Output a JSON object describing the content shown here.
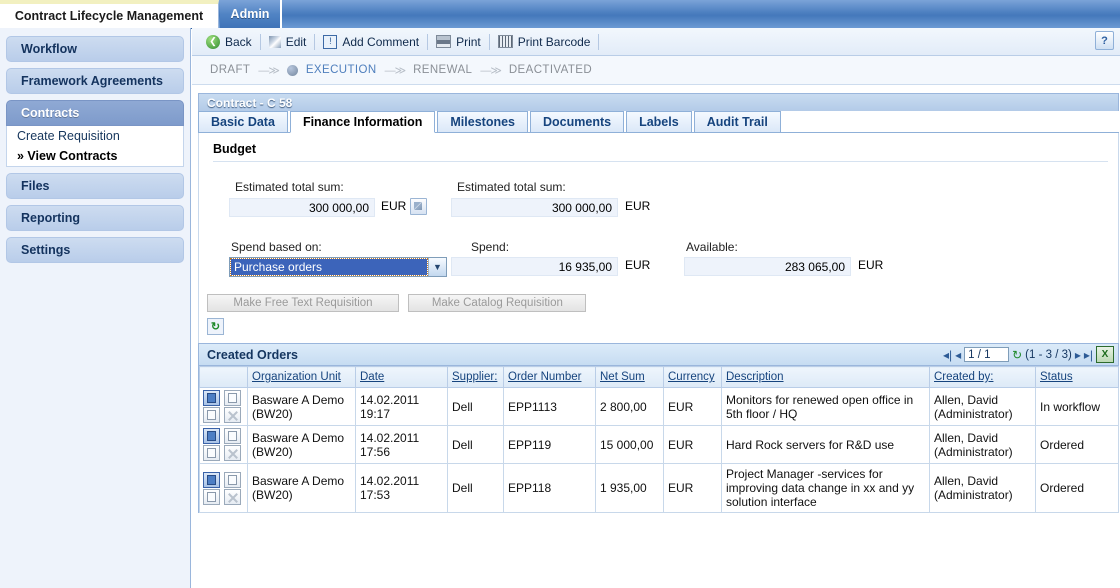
{
  "top_tabs": [
    {
      "label": "Contract Lifecycle Management",
      "active": true
    },
    {
      "label": "Admin",
      "active": false
    }
  ],
  "sidebar": {
    "items": [
      {
        "label": "Workflow",
        "selected": false
      },
      {
        "label": "Framework Agreements",
        "selected": false
      },
      {
        "label": "Contracts",
        "selected": true
      },
      {
        "label": "Files",
        "selected": false
      },
      {
        "label": "Reporting",
        "selected": false
      },
      {
        "label": "Settings",
        "selected": false
      }
    ],
    "sub_items": [
      {
        "label": "Create Requisition",
        "current": false
      },
      {
        "label": "» View Contracts",
        "current": true
      }
    ]
  },
  "toolbar": {
    "back": "Back",
    "edit": "Edit",
    "add_comment": "Add Comment",
    "print": "Print",
    "print_barcode": "Print Barcode",
    "help": "?"
  },
  "status_flow": {
    "steps": [
      "DRAFT",
      "EXECUTION",
      "RENEWAL",
      "DEACTIVATED"
    ],
    "current": "EXECUTION",
    "arrow": "—≫"
  },
  "page_title": "Contract - C 58",
  "tabs": [
    {
      "label": "Basic Data",
      "active": false
    },
    {
      "label": "Finance Information",
      "active": true
    },
    {
      "label": "Milestones",
      "active": false
    },
    {
      "label": "Documents",
      "active": false
    },
    {
      "label": "Labels",
      "active": false
    },
    {
      "label": "Audit Trail",
      "active": false
    }
  ],
  "budget": {
    "section_title": "Budget",
    "estimated_label_1": "Estimated total sum:",
    "estimated_value_1": "300 000,00",
    "estimated_unit_1": "EUR",
    "estimated_label_2": "Estimated total sum:",
    "estimated_value_2": "300 000,00",
    "estimated_unit_2": "EUR",
    "spend_based_on_label": "Spend based on:",
    "spend_based_on_value": "Purchase orders",
    "spend_label": "Spend:",
    "spend_value": "16 935,00",
    "spend_unit": "EUR",
    "available_label": "Available:",
    "available_value": "283 065,00",
    "available_unit": "EUR"
  },
  "actions": {
    "free_text_requisition": "Make Free Text Requisition",
    "catalog_requisition": "Make Catalog Requisition"
  },
  "orders": {
    "title": "Created Orders",
    "pager": {
      "page": "1 / 1",
      "range": "(1 - 3 / 3)"
    },
    "columns": [
      "",
      "Organization Unit",
      "Date",
      "Supplier:",
      "Order Number",
      "Net Sum",
      "Currency",
      "Description",
      "Created by:",
      "Status"
    ],
    "rows": [
      {
        "organization_unit": "Basware A Demo (BW20)",
        "date": "14.02.2011 19:17",
        "supplier": "Dell",
        "order_number": "EPP1113",
        "net_sum": "2 800,00",
        "currency": "EUR",
        "description": "Monitors for renewed open office in 5th floor / HQ",
        "created_by": "Allen, David (Administrator)",
        "status": "In workflow"
      },
      {
        "organization_unit": "Basware A Demo (BW20)",
        "date": "14.02.2011 17:56",
        "supplier": "Dell",
        "order_number": "EPP119",
        "net_sum": "15 000,00",
        "currency": "EUR",
        "description": "Hard Rock servers for R&D use",
        "created_by": "Allen, David (Administrator)",
        "status": "Ordered"
      },
      {
        "organization_unit": "Basware A Demo (BW20)",
        "date": "14.02.2011 17:53",
        "supplier": "Dell",
        "order_number": "EPP118",
        "net_sum": "1 935,00",
        "currency": "EUR",
        "description": "Project Manager -services for improving data change in xx and yy solution interface",
        "created_by": "Allen, David (Administrator)",
        "status": "Ordered"
      }
    ]
  },
  "colors": {
    "accent": "#4478bb",
    "selected_nav": "#8fa9d4",
    "select_highlight": "#3c64ba",
    "panel_border": "#9ab6dc"
  }
}
